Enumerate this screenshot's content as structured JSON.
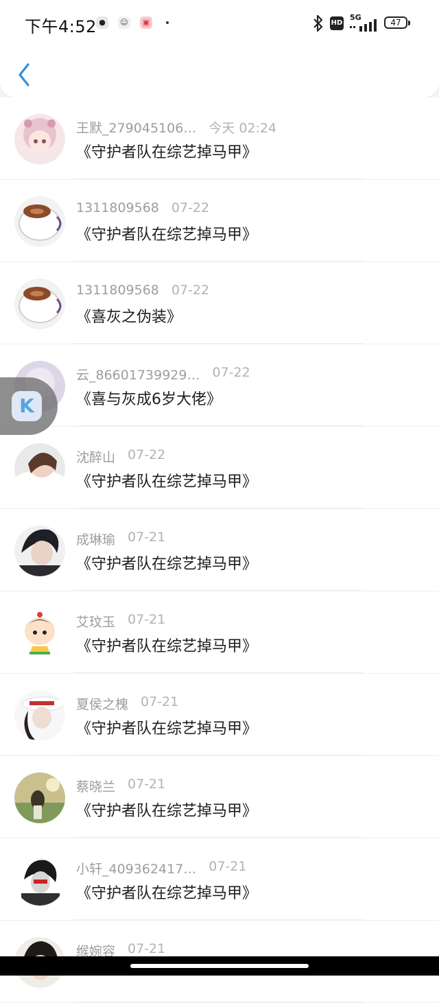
{
  "status_bar": {
    "time": "下午4:52",
    "network": "5G",
    "hd": "HD",
    "battery": "47"
  },
  "header": {
    "back_icon": "chevron-left-icon"
  },
  "colors": {
    "accent": "#2f8fe0",
    "name_gray": "#9d9d9d",
    "title_dark": "#1e1e1e"
  },
  "items": [
    {
      "name": "王默_279045106…",
      "time": "今天 02:24",
      "title": "《守护者队在综艺掉马甲》"
    },
    {
      "name": "1311809568",
      "time": "07-22",
      "title": "《守护者队在综艺掉马甲》"
    },
    {
      "name": "1311809568",
      "time": "07-22",
      "title": "《喜灰之伪装》"
    },
    {
      "name": "云_86601739929…",
      "time": "07-22",
      "title": "《喜与灰成6岁大佬》"
    },
    {
      "name": "沈醉山",
      "time": "07-22",
      "title": "《守护者队在综艺掉马甲》"
    },
    {
      "name": "成琳瑜",
      "time": "07-21",
      "title": "《守护者队在综艺掉马甲》"
    },
    {
      "name": "艾玟玉",
      "time": "07-21",
      "title": "《守护者队在综艺掉马甲》"
    },
    {
      "name": "夏侯之槐",
      "time": "07-21",
      "title": "《守护者队在综艺掉马甲》"
    },
    {
      "name": "蔡晓兰",
      "time": "07-21",
      "title": "《守护者队在综艺掉马甲》"
    },
    {
      "name": "小轩_409362417…",
      "time": "07-21",
      "title": "《守护者队在综艺掉马甲》"
    },
    {
      "name": "缑婉容",
      "time": "07-21",
      "title": ""
    }
  ],
  "floating_button": {
    "label": "K"
  }
}
